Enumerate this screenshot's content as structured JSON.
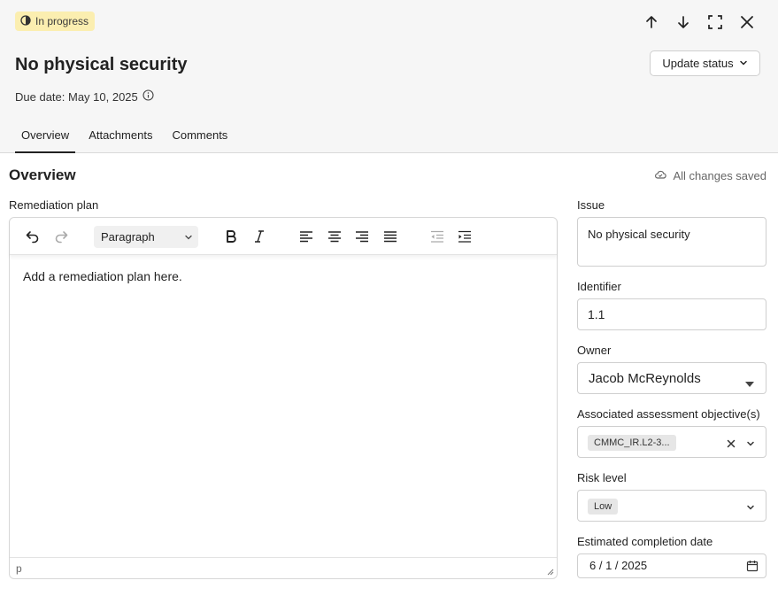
{
  "header": {
    "status": "In progress",
    "title": "No physical security",
    "due_date": "Due date: May 10, 2025",
    "update_button": "Update status",
    "tabs": [
      "Overview",
      "Attachments",
      "Comments"
    ]
  },
  "overview": {
    "title": "Overview",
    "saved_status": "All changes saved",
    "remediation_label": "Remediation plan",
    "editor": {
      "format": "Paragraph",
      "placeholder": "Add a remediation plan here.",
      "statusbar": "p"
    }
  },
  "fields": {
    "issue_label": "Issue",
    "issue_value": "No physical security",
    "identifier_label": "Identifier",
    "identifier_value": "1.1",
    "owner_label": "Owner",
    "owner_value": "Jacob McReynolds",
    "objective_label": "Associated assessment objective(s)",
    "objective_tag": "CMMC_IR.L2-3...",
    "risk_label": "Risk level",
    "risk_tag": "Low",
    "completion_label": "Estimated completion date",
    "completion_value": "6 / 1 / 2025"
  },
  "icons": [
    "in-progress-icon",
    "arrow-up-icon",
    "arrow-down-icon",
    "fullscreen-icon",
    "close-icon",
    "chevron-down-icon",
    "info-icon",
    "cloud-icon",
    "undo-icon",
    "redo-icon",
    "bold-icon",
    "italic-icon",
    "align-left-icon",
    "align-center-icon",
    "align-right-icon",
    "align-justify-icon",
    "outdent-icon",
    "indent-icon",
    "calendar-icon"
  ],
  "colors": {
    "status_bg": "#fbeeb0",
    "header_bg": "#f6f6f6",
    "tag_bg": "#e6e6e6"
  }
}
